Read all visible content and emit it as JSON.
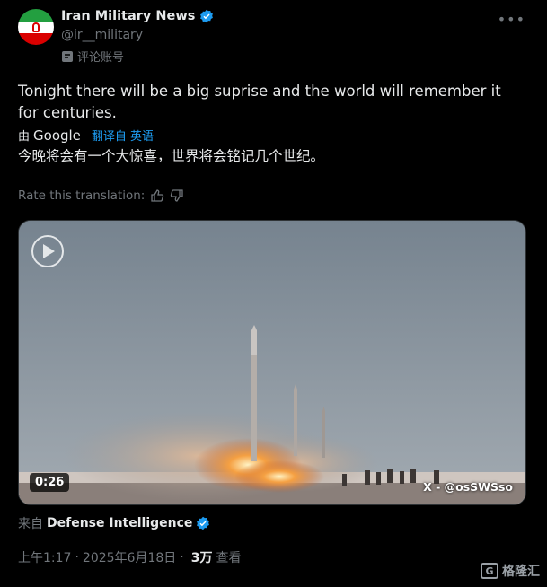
{
  "account": {
    "display_name": "Iran Military News",
    "handle": "@ir__military",
    "label": "评论账号"
  },
  "tweet": {
    "text": "Tonight there will be a big suprise and the world will remember it for centuries.",
    "translation_by": "由",
    "translation_engine": "Google",
    "translated_from": "翻译自 英语",
    "translation": "今晚将会有一个大惊喜，世界将会铭记几个世纪。",
    "rate_prompt": "Rate this translation:"
  },
  "media": {
    "duration": "0:26",
    "credit": "X - @osSWSso"
  },
  "source": {
    "prefix": "来自",
    "name": "Defense Intelligence"
  },
  "meta": {
    "time": "上午1:17",
    "date": "2025年6月18日",
    "views": "3万",
    "views_label": "查看",
    "separator": "·"
  },
  "brand": {
    "name": "格隆汇",
    "mark": "G"
  },
  "colors": {
    "background": "#000000",
    "text": "#e7e9ea",
    "muted": "#71767b",
    "accent": "#1d9bf0"
  }
}
